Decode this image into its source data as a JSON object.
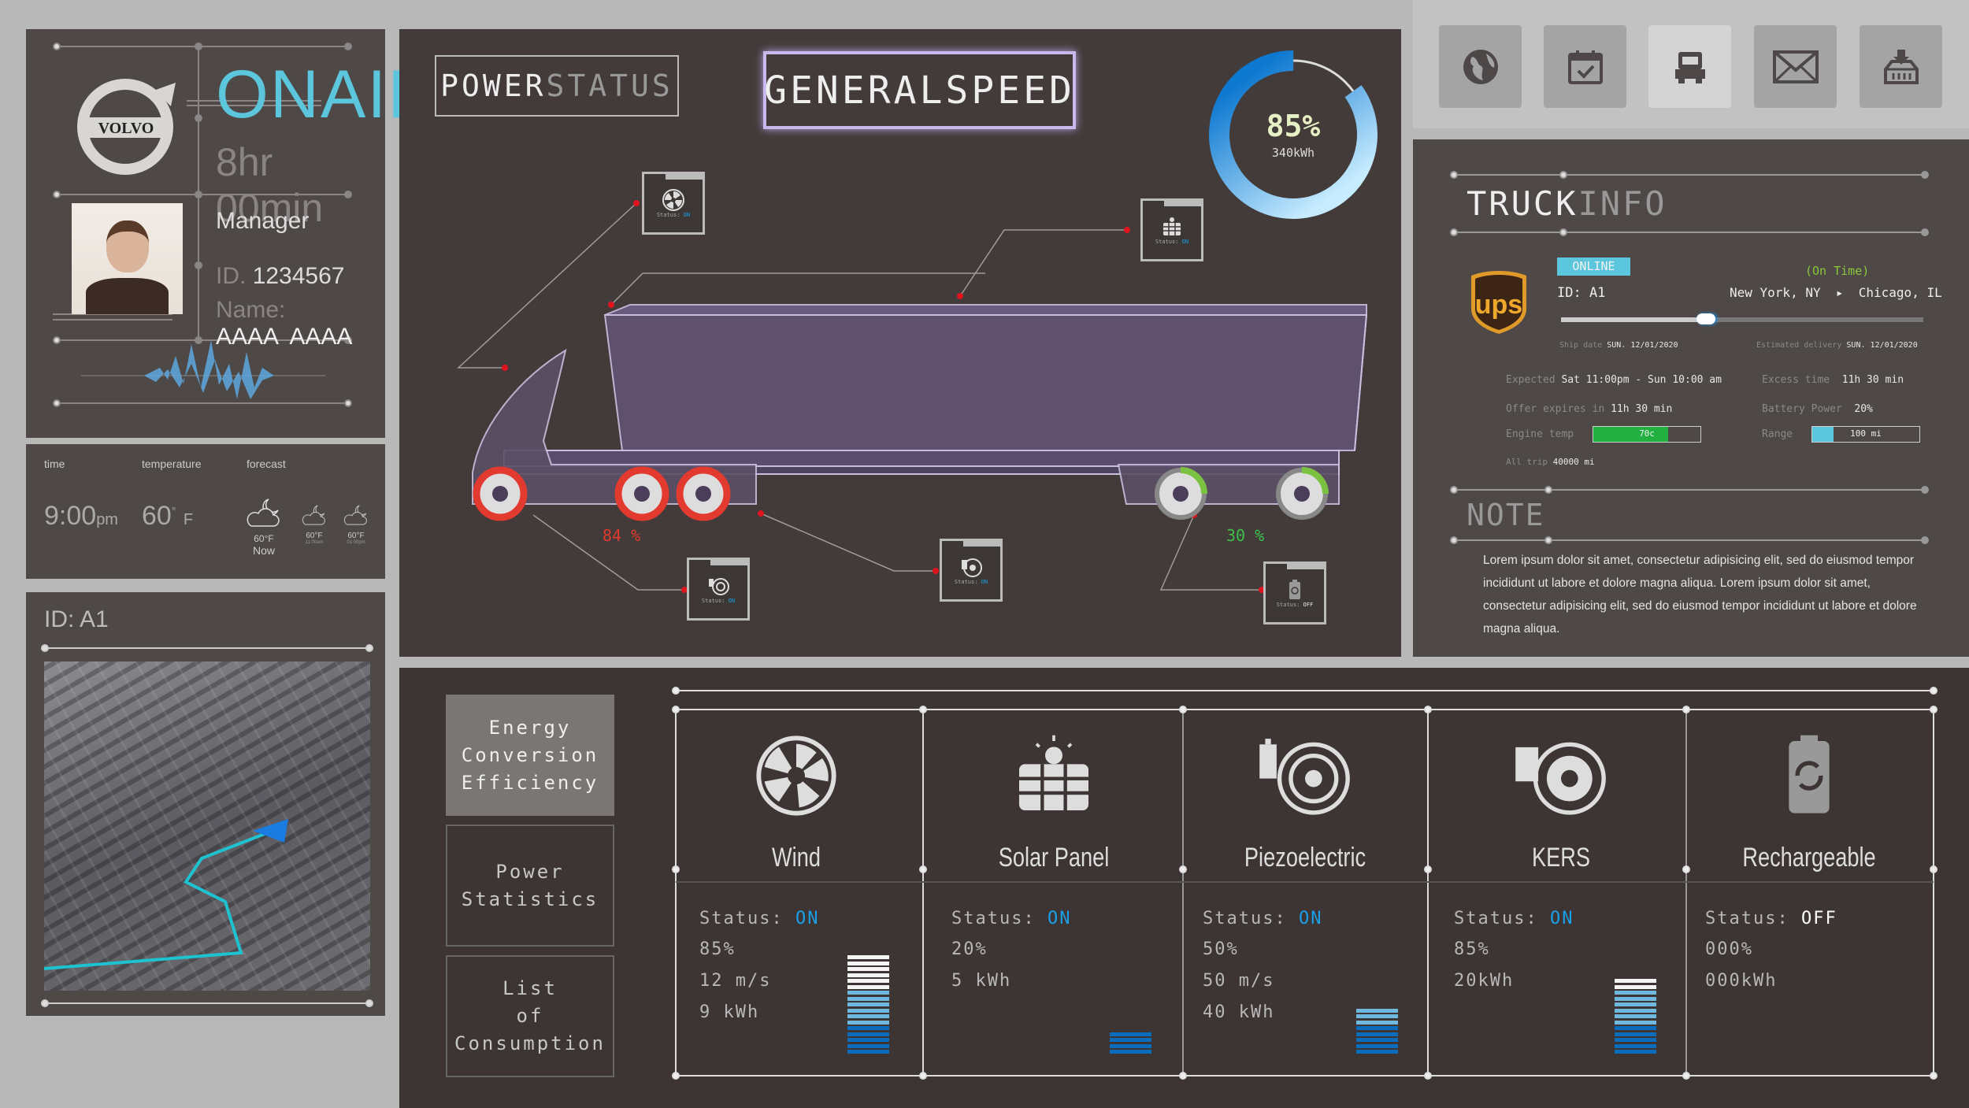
{
  "profile": {
    "brand": "VOLVO",
    "title": "ONAIR",
    "duration": "8hr 00min",
    "role": "Manager",
    "id_label": "ID.",
    "id_value": "1234567",
    "name_label": "Name:",
    "name_value": "AAAA  AAAA"
  },
  "weather": {
    "time_label": "time",
    "temp_label": "temperature",
    "forecast_label": "forecast",
    "time": "9:00",
    "time_suffix": "pm",
    "temp": "60",
    "temp_unit": "F",
    "forecast": [
      {
        "temp": "60°F",
        "label": "Now"
      },
      {
        "temp": "60°F",
        "label": "11:00am"
      },
      {
        "temp": "60°F",
        "label": "01:00pm"
      }
    ]
  },
  "map": {
    "title": "ID: A1"
  },
  "center": {
    "power_status": {
      "a": "POWER",
      "b": "STATUS"
    },
    "general_speed": "GENERALSPEED",
    "gauge": {
      "percent": 85,
      "label": "85%",
      "energy": "340kWh"
    },
    "wheel_left_pct": "84 %",
    "wheel_right_pct": "30 %",
    "status_boxes": [
      {
        "prefix": "Status:",
        "state": "ON",
        "icon": "fan-icon"
      },
      {
        "prefix": "Status:",
        "state": "ON",
        "icon": "solar-panel-icon"
      },
      {
        "prefix": "Status:",
        "state": "ON",
        "icon": "piezo-icon"
      },
      {
        "prefix": "Status:",
        "state": "ON",
        "icon": "kers-icon"
      },
      {
        "prefix": "Status:",
        "state": "OFF",
        "icon": "battery-icon"
      }
    ]
  },
  "top_nav": [
    {
      "icon": "globe-icon"
    },
    {
      "icon": "calendar-check-icon"
    },
    {
      "icon": "truck-icon",
      "active": true
    },
    {
      "icon": "envelope-icon"
    },
    {
      "icon": "download-box-icon"
    }
  ],
  "truck_info": {
    "title_a": "TRUCK",
    "title_b": "INFO",
    "carrier": "ups",
    "status": "ONLINE",
    "on_time": "(On Time)",
    "id": "ID: A1",
    "route": "New York, NY  ▸  Chicago, IL",
    "progress": 0.4,
    "ship_label": "Ship date",
    "ship_date": "SUN. 12/01/2020",
    "eta_label": "Estimated delivery",
    "eta_date": "SUN. 12/01/2020",
    "expected_label": "Expected",
    "expected": "Sat 11:00pm - Sun 10:00 am",
    "excess_label": "Excess time",
    "excess": "11h 30 min",
    "offer_label": "Offer expires in",
    "offer": "11h 30 min",
    "battery_label": "Battery Power",
    "battery": "20%",
    "engine_label": "Engine temp",
    "engine": "70c",
    "engine_level": 0.7,
    "range_label": "Range",
    "range": "100 mi",
    "range_level": 0.2,
    "trip_label": "All trip",
    "trip": "40000 mi"
  },
  "note": {
    "title": "NOTE",
    "text": "Lorem ipsum dolor sit amet, consectetur adipisicing elit, sed do eiusmod tempor incididunt ut labore et dolore magna aliqua. Lorem ipsum dolor sit amet, consectetur adipisicing elit, sed do eiusmod tempor incididunt ut labore et dolore magna aliqua."
  },
  "menu": [
    {
      "label": "Energy\nConversion\nEfficiency",
      "active": true
    },
    {
      "label": "Power\nStatistics"
    },
    {
      "label": "List\nof\nConsumption"
    }
  ],
  "sources": [
    {
      "name": "Wind",
      "status_label": "Status:",
      "status": "ON",
      "values": [
        "85%",
        "12 m/s",
        "9 kWh"
      ],
      "bars": {
        "white": 6,
        "light": 6,
        "dark": 5
      }
    },
    {
      "name": "Solar Panel",
      "status_label": "Status:",
      "status": "ON",
      "values": [
        "20%",
        "5 kWh"
      ],
      "bars": {
        "white": 0,
        "light": 0,
        "dark": 4
      }
    },
    {
      "name": "Piezoelectric",
      "status_label": "Status:",
      "status": "ON",
      "values": [
        "50%",
        "50 m/s",
        "40 kWh"
      ],
      "bars": {
        "white": 0,
        "light": 3,
        "dark": 5
      }
    },
    {
      "name": "KERS",
      "status_label": "Status:",
      "status": "ON",
      "values": [
        "85%",
        "20kWh"
      ],
      "bars": {
        "white": 2,
        "light": 6,
        "dark": 5
      }
    },
    {
      "name": "Rechargeable",
      "status_label": "Status:",
      "status": "OFF",
      "values": [
        "000%",
        "000kWh"
      ],
      "bars": {
        "white": 0,
        "light": 0,
        "dark": 0
      }
    }
  ],
  "colors": {
    "accent": "#1aa0e8",
    "cyan": "#5bc6dc",
    "red": "#e23a2e",
    "green": "#7cc242",
    "panel": "#4e4846"
  }
}
